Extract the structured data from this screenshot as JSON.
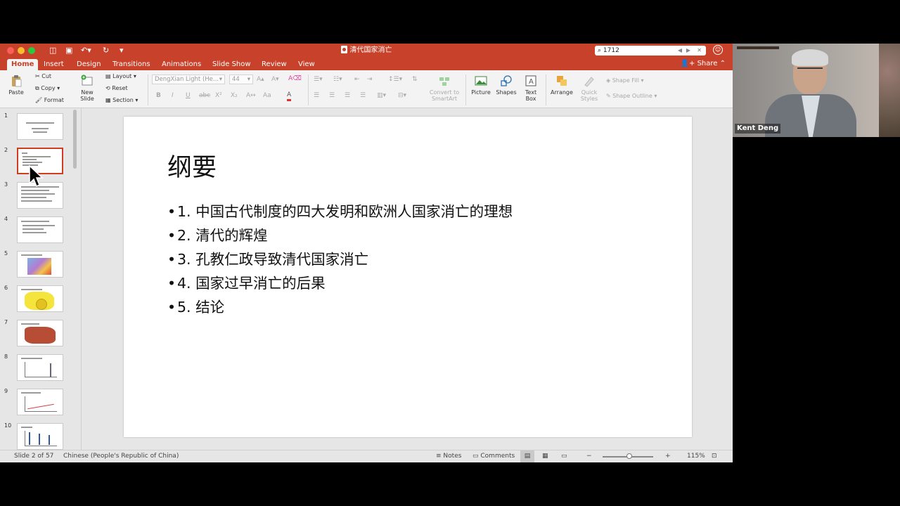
{
  "window": {
    "title": "清代国家消亡",
    "search_value": "1712"
  },
  "tabs": [
    {
      "label": "Home",
      "active": true
    },
    {
      "label": "Insert"
    },
    {
      "label": "Design"
    },
    {
      "label": "Transitions"
    },
    {
      "label": "Animations"
    },
    {
      "label": "Slide Show"
    },
    {
      "label": "Review"
    },
    {
      "label": "View"
    }
  ],
  "share_label": "Share",
  "ribbon": {
    "paste": "Paste",
    "cut": "Cut",
    "copy": "Copy",
    "format": "Format",
    "new_slide": "New Slide",
    "layout": "Layout",
    "reset": "Reset",
    "section": "Section",
    "font_name": "DengXian Light (He...",
    "font_size": "44",
    "convert_smartart": "Convert to SmartArt",
    "picture": "Picture",
    "shapes": "Shapes",
    "text_box": "Text Box",
    "arrange": "Arrange",
    "quick_styles": "Quick Styles",
    "shape_fill": "Shape Fill",
    "shape_outline": "Shape Outline"
  },
  "thumbnails": [
    "1",
    "2",
    "3",
    "4",
    "5",
    "6",
    "7",
    "8",
    "9",
    "10"
  ],
  "slide": {
    "title": "纲要",
    "bullets": [
      "1. 中国古代制度的四大发明和欧洲人国家消亡的理想",
      "2. 清代的辉煌",
      "3. 孔教仁政导致清代国家消亡",
      "4. 国家过早消亡的后果",
      "5. 结论"
    ]
  },
  "status": {
    "slide_info": "Slide 2 of 57",
    "language": "Chinese (People's Republic of China)",
    "notes": "Notes",
    "comments": "Comments",
    "zoom": "115%"
  },
  "video": {
    "participant_name": "Kent Deng"
  },
  "colors": {
    "accent": "#c8412a",
    "selection": "#d13b22"
  }
}
